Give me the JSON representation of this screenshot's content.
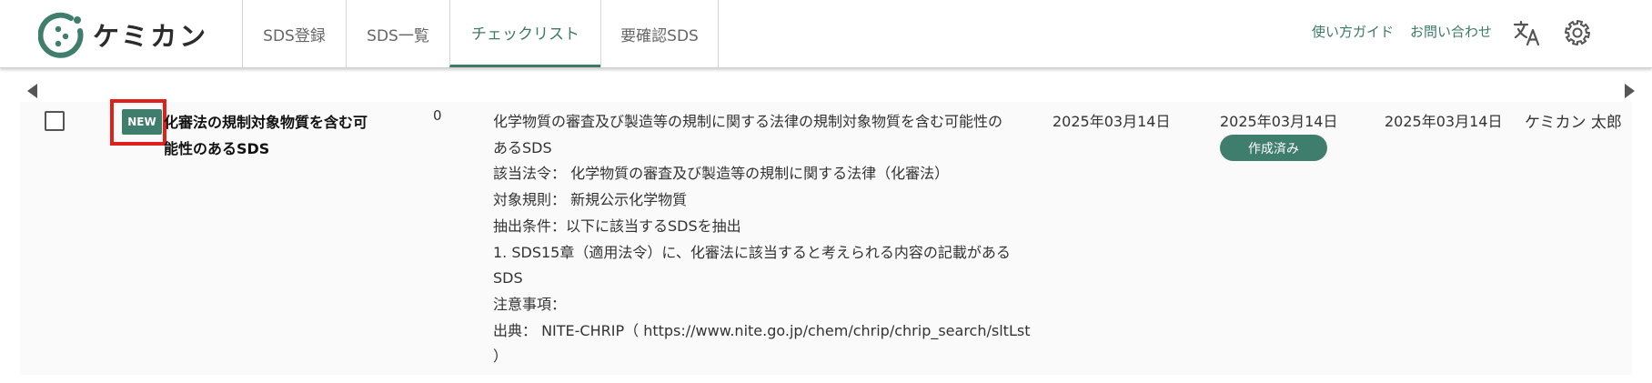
{
  "header": {
    "logo_text": "ケミカン",
    "tabs": [
      {
        "label": "SDS登録",
        "active": false
      },
      {
        "label": "SDS一覧",
        "active": false
      },
      {
        "label": "チェックリスト",
        "active": true
      },
      {
        "label": "要確認SDS",
        "active": false
      }
    ],
    "links": {
      "guide": "使い方ガイド",
      "contact": "お問い合わせ"
    },
    "icons": {
      "translate": "translate-icon",
      "settings": "gear-icon"
    },
    "accent_color": "#3c7a66"
  },
  "row": {
    "badge": "NEW",
    "title_lines": [
      "化審法の規制対象物質を含む可",
      "能性のあるSDS"
    ],
    "count": "0",
    "description_lines": [
      "化学物質の審査及び製造等の規制に関する法律の規制対象物質を含む可能性の",
      "あるSDS",
      "該当法令： 化学物質の審査及び製造等の規制に関する法律（化審法）",
      "対象規則： 新規公示化学物質",
      "抽出条件：以下に該当するSDSを抽出",
      "1. SDS15章（適用法令）に、化審法に該当すると考えられる内容の記載がある",
      "SDS",
      "注意事項：",
      "出典： NITE-CHRIP（ https://www.nite.go.jp/chem/chrip/chrip_search/sltLst",
      "）"
    ],
    "date_1": "2025年03月14日",
    "date_2": "2025年03月14日",
    "status": "作成済み",
    "date_3": "2025年03月14日",
    "user": "ケミカン 太郎"
  }
}
